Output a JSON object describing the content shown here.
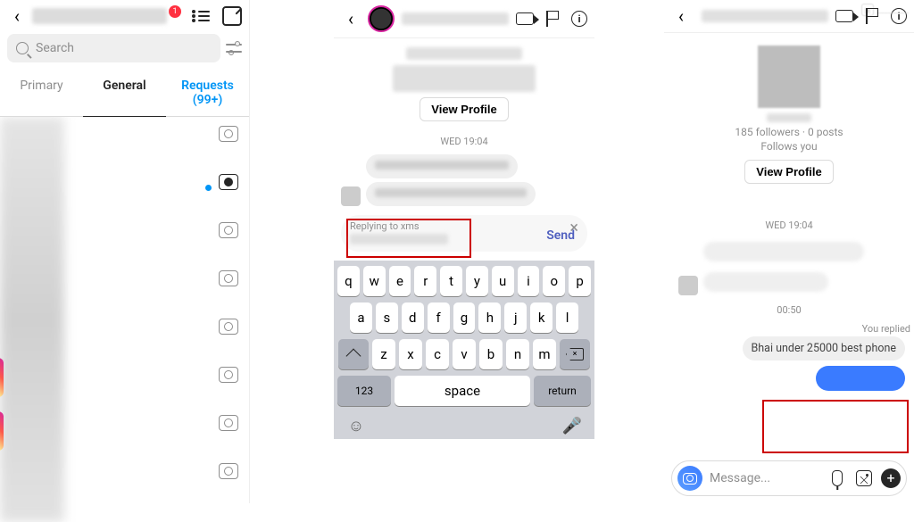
{
  "inbox": {
    "badge": "1",
    "search_placeholder": "Search",
    "tabs": {
      "primary": "Primary",
      "general": "General",
      "requests": "Requests (99+)"
    }
  },
  "chat": {
    "view_profile": "View Profile",
    "timestamp": "WED 19:04",
    "visible_msg_fragment": "",
    "reply_label": "Replying to xms",
    "send": "Send",
    "keyboard": {
      "row1": [
        "q",
        "w",
        "e",
        "r",
        "t",
        "y",
        "u",
        "i",
        "o",
        "p"
      ],
      "row2": [
        "a",
        "s",
        "d",
        "f",
        "g",
        "h",
        "j",
        "k",
        "l"
      ],
      "row3": [
        "z",
        "x",
        "c",
        "v",
        "b",
        "n",
        "m"
      ],
      "num": "123",
      "space": "space",
      "return": "return"
    }
  },
  "chat2": {
    "stats": "185 followers · 0 posts",
    "follows": "Follows you",
    "view_profile": "View Profile",
    "timestamp": "WED 19:04",
    "time2": "00:50",
    "you_replied": "You replied",
    "reply_text": "Bhai under 25000 best phone",
    "composer_placeholder": "Message..."
  }
}
